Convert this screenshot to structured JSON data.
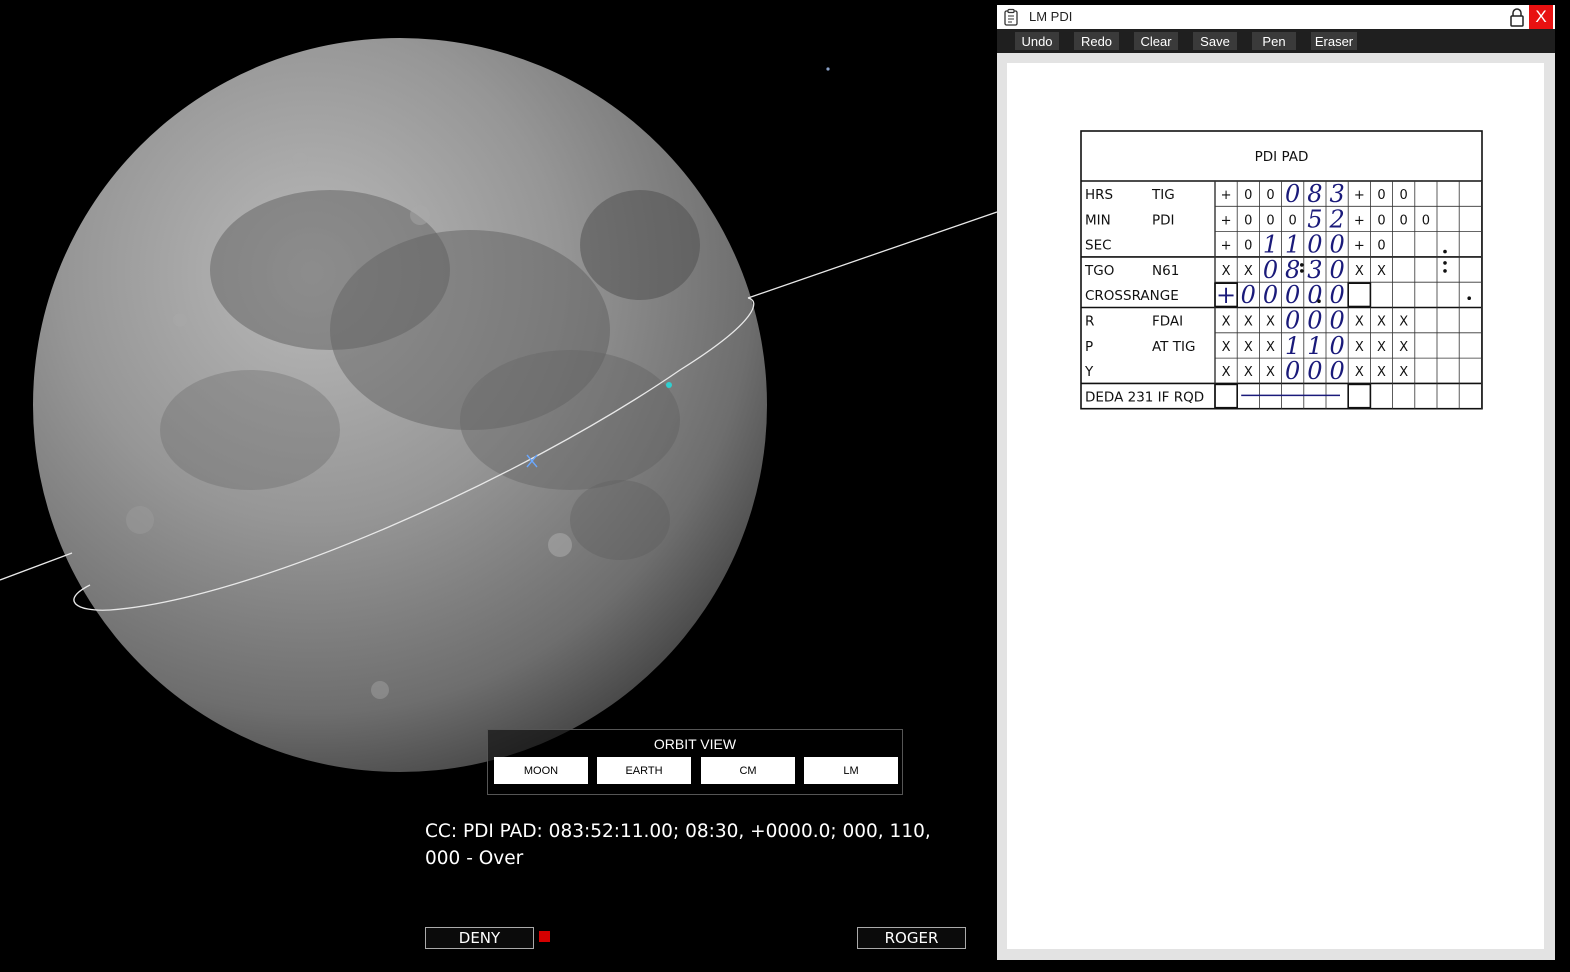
{
  "orbit_view": {
    "title": "ORBIT VIEW",
    "buttons": [
      "MOON",
      "EARTH",
      "CM",
      "LM"
    ]
  },
  "message": "CC: PDI PAD: 083:52:11.00; 08:30, +0000.0; 000, 110, 000 - Over",
  "actions": {
    "deny": "DENY",
    "roger": "ROGER"
  },
  "window": {
    "title": "LM PDI",
    "close_glyph": "X",
    "toolbar": [
      "Undo",
      "Redo",
      "Clear",
      "Save",
      "Pen",
      "Eraser"
    ]
  },
  "pad": {
    "title": "PDI  PAD",
    "rows": [
      {
        "label": "HRS",
        "sublabel": "TIG"
      },
      {
        "label": "MIN",
        "sublabel": "PDI"
      },
      {
        "label": "SEC",
        "sublabel": ""
      },
      {
        "label": "TGO",
        "sublabel": "N61"
      },
      {
        "label": "CROSSRANGE",
        "sublabel": ""
      },
      {
        "label": "R",
        "sublabel": "FDAI"
      },
      {
        "label": "P",
        "sublabel": "AT TIG"
      },
      {
        "label": "Y",
        "sublabel": ""
      },
      {
        "label": "DEDA 231 IF RQD",
        "sublabel": ""
      }
    ],
    "cells": [
      [
        "+",
        "0",
        "0",
        "",
        "",
        "",
        "+",
        "0",
        "0",
        "",
        "",
        ""
      ],
      [
        "+",
        "0",
        "0",
        "0",
        "",
        "",
        "+",
        "0",
        "0",
        "0",
        "",
        ""
      ],
      [
        "+",
        "0",
        "",
        "",
        "",
        "",
        "+",
        "0",
        "",
        "",
        "",
        ""
      ],
      [
        "X",
        "X",
        "",
        "",
        "",
        "",
        "X",
        "X",
        "",
        "",
        "",
        ""
      ],
      [
        "",
        "",
        "",
        "",
        "",
        "",
        "",
        "",
        "",
        "",
        "",
        ""
      ],
      [
        "X",
        "X",
        "X",
        "",
        "",
        "",
        "X",
        "X",
        "X",
        "",
        "",
        ""
      ],
      [
        "X",
        "X",
        "X",
        "",
        "",
        "",
        "X",
        "X",
        "X",
        "",
        "",
        ""
      ],
      [
        "X",
        "X",
        "X",
        "",
        "",
        "",
        "X",
        "X",
        "X",
        "",
        "",
        ""
      ],
      [
        "",
        "",
        "",
        "",
        "",
        "",
        "",
        "",
        "",
        "",
        "",
        ""
      ]
    ],
    "handwritten": [
      [
        "",
        "",
        "",
        "0",
        "8",
        "3",
        "",
        "",
        "",
        "",
        "",
        ""
      ],
      [
        "",
        "",
        "",
        "",
        "5",
        "2",
        "",
        "",
        "",
        "",
        "",
        ""
      ],
      [
        "",
        "",
        "1",
        "1",
        "0",
        "0",
        "",
        "",
        "",
        "",
        "",
        ""
      ],
      [
        "",
        "",
        "0",
        "8",
        "3",
        "0",
        "",
        "",
        "",
        "",
        "",
        ""
      ],
      [
        "+",
        "0",
        "0",
        "0",
        "0",
        "0",
        "",
        "",
        "",
        "",
        "",
        ""
      ],
      [
        "",
        "",
        "",
        "0",
        "0",
        "0",
        "",
        "",
        "",
        "",
        "",
        ""
      ],
      [
        "",
        "",
        "",
        "1",
        "1",
        "0",
        "",
        "",
        "",
        "",
        "",
        ""
      ],
      [
        "",
        "",
        "",
        "0",
        "0",
        "0",
        "",
        "",
        "",
        "",
        "",
        ""
      ],
      [
        "",
        "",
        "",
        "",
        "",
        "",
        "",
        "",
        "",
        "",
        "",
        ""
      ]
    ],
    "ink_color": "#1a1a7a"
  },
  "colors": {
    "accent_red": "#e81111",
    "indicator": "#d40000"
  }
}
